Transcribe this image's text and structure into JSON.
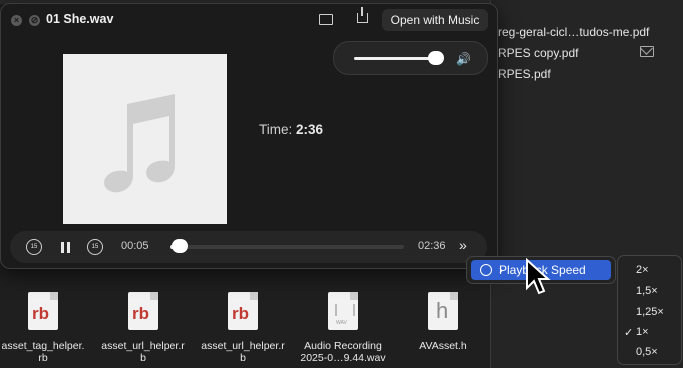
{
  "window": {
    "title": "01 She.wav",
    "open_label": "Open with Music",
    "time_label": "Time:",
    "time_value": "2:36",
    "current_time": "00:05",
    "total_time": "02:36",
    "volume": 0.9,
    "progress": 0.03,
    "skip_back": "15",
    "skip_fwd": "15"
  },
  "right_files": [
    "reg-geral-cicl…tudos-me.pdf",
    "RPES copy.pdf",
    "RPES.pdf"
  ],
  "files": [
    {
      "name": "asset_tag_helper.\nrb",
      "kind": "rb"
    },
    {
      "name": "asset_url_helper.r\nb",
      "kind": "rb"
    },
    {
      "name": "asset_url_helper.r\nb",
      "kind": "rb"
    },
    {
      "name": "Audio Recording\n2025-0…9.44.wav",
      "kind": "wav"
    },
    {
      "name": "AVAsset.h",
      "kind": "h"
    }
  ],
  "file_icon_text": {
    "rb": "rb",
    "h": "h",
    "wav": "WAV"
  },
  "context_menu": {
    "item": "Playback Speed"
  },
  "speed_menu": {
    "options": [
      "2×",
      "1,5×",
      "1,25×",
      "1×",
      "0,5×"
    ],
    "selected": "1×"
  }
}
